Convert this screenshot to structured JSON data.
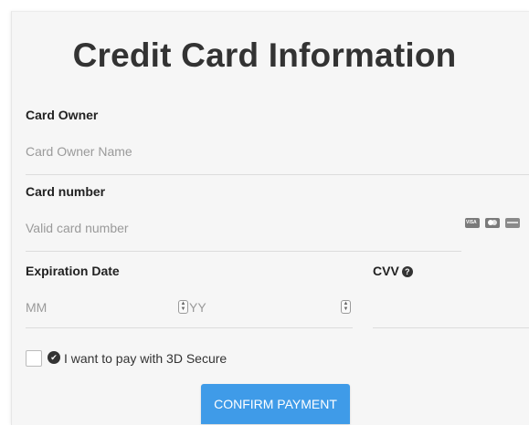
{
  "title": "Credit Card Information",
  "owner": {
    "label": "Card Owner",
    "placeholder": "Card Owner Name"
  },
  "number": {
    "label": "Card number",
    "placeholder": "Valid card number",
    "card_icons": [
      "visa-icon",
      "mastercard-icon",
      "amex-icon"
    ]
  },
  "expiration": {
    "label": "Expiration Date",
    "month_placeholder": "MM",
    "year_placeholder": "YY"
  },
  "cvv": {
    "label": "CVV",
    "help_icon": "question-circle-icon"
  },
  "secure": {
    "label": "I want to pay with 3D Secure",
    "checked": false
  },
  "submit_label": "CONFIRM PAYMENT",
  "colors": {
    "accent": "#3f9be8",
    "background": "#f6f6f6",
    "text": "#333333",
    "placeholder": "#9a9a9a"
  }
}
